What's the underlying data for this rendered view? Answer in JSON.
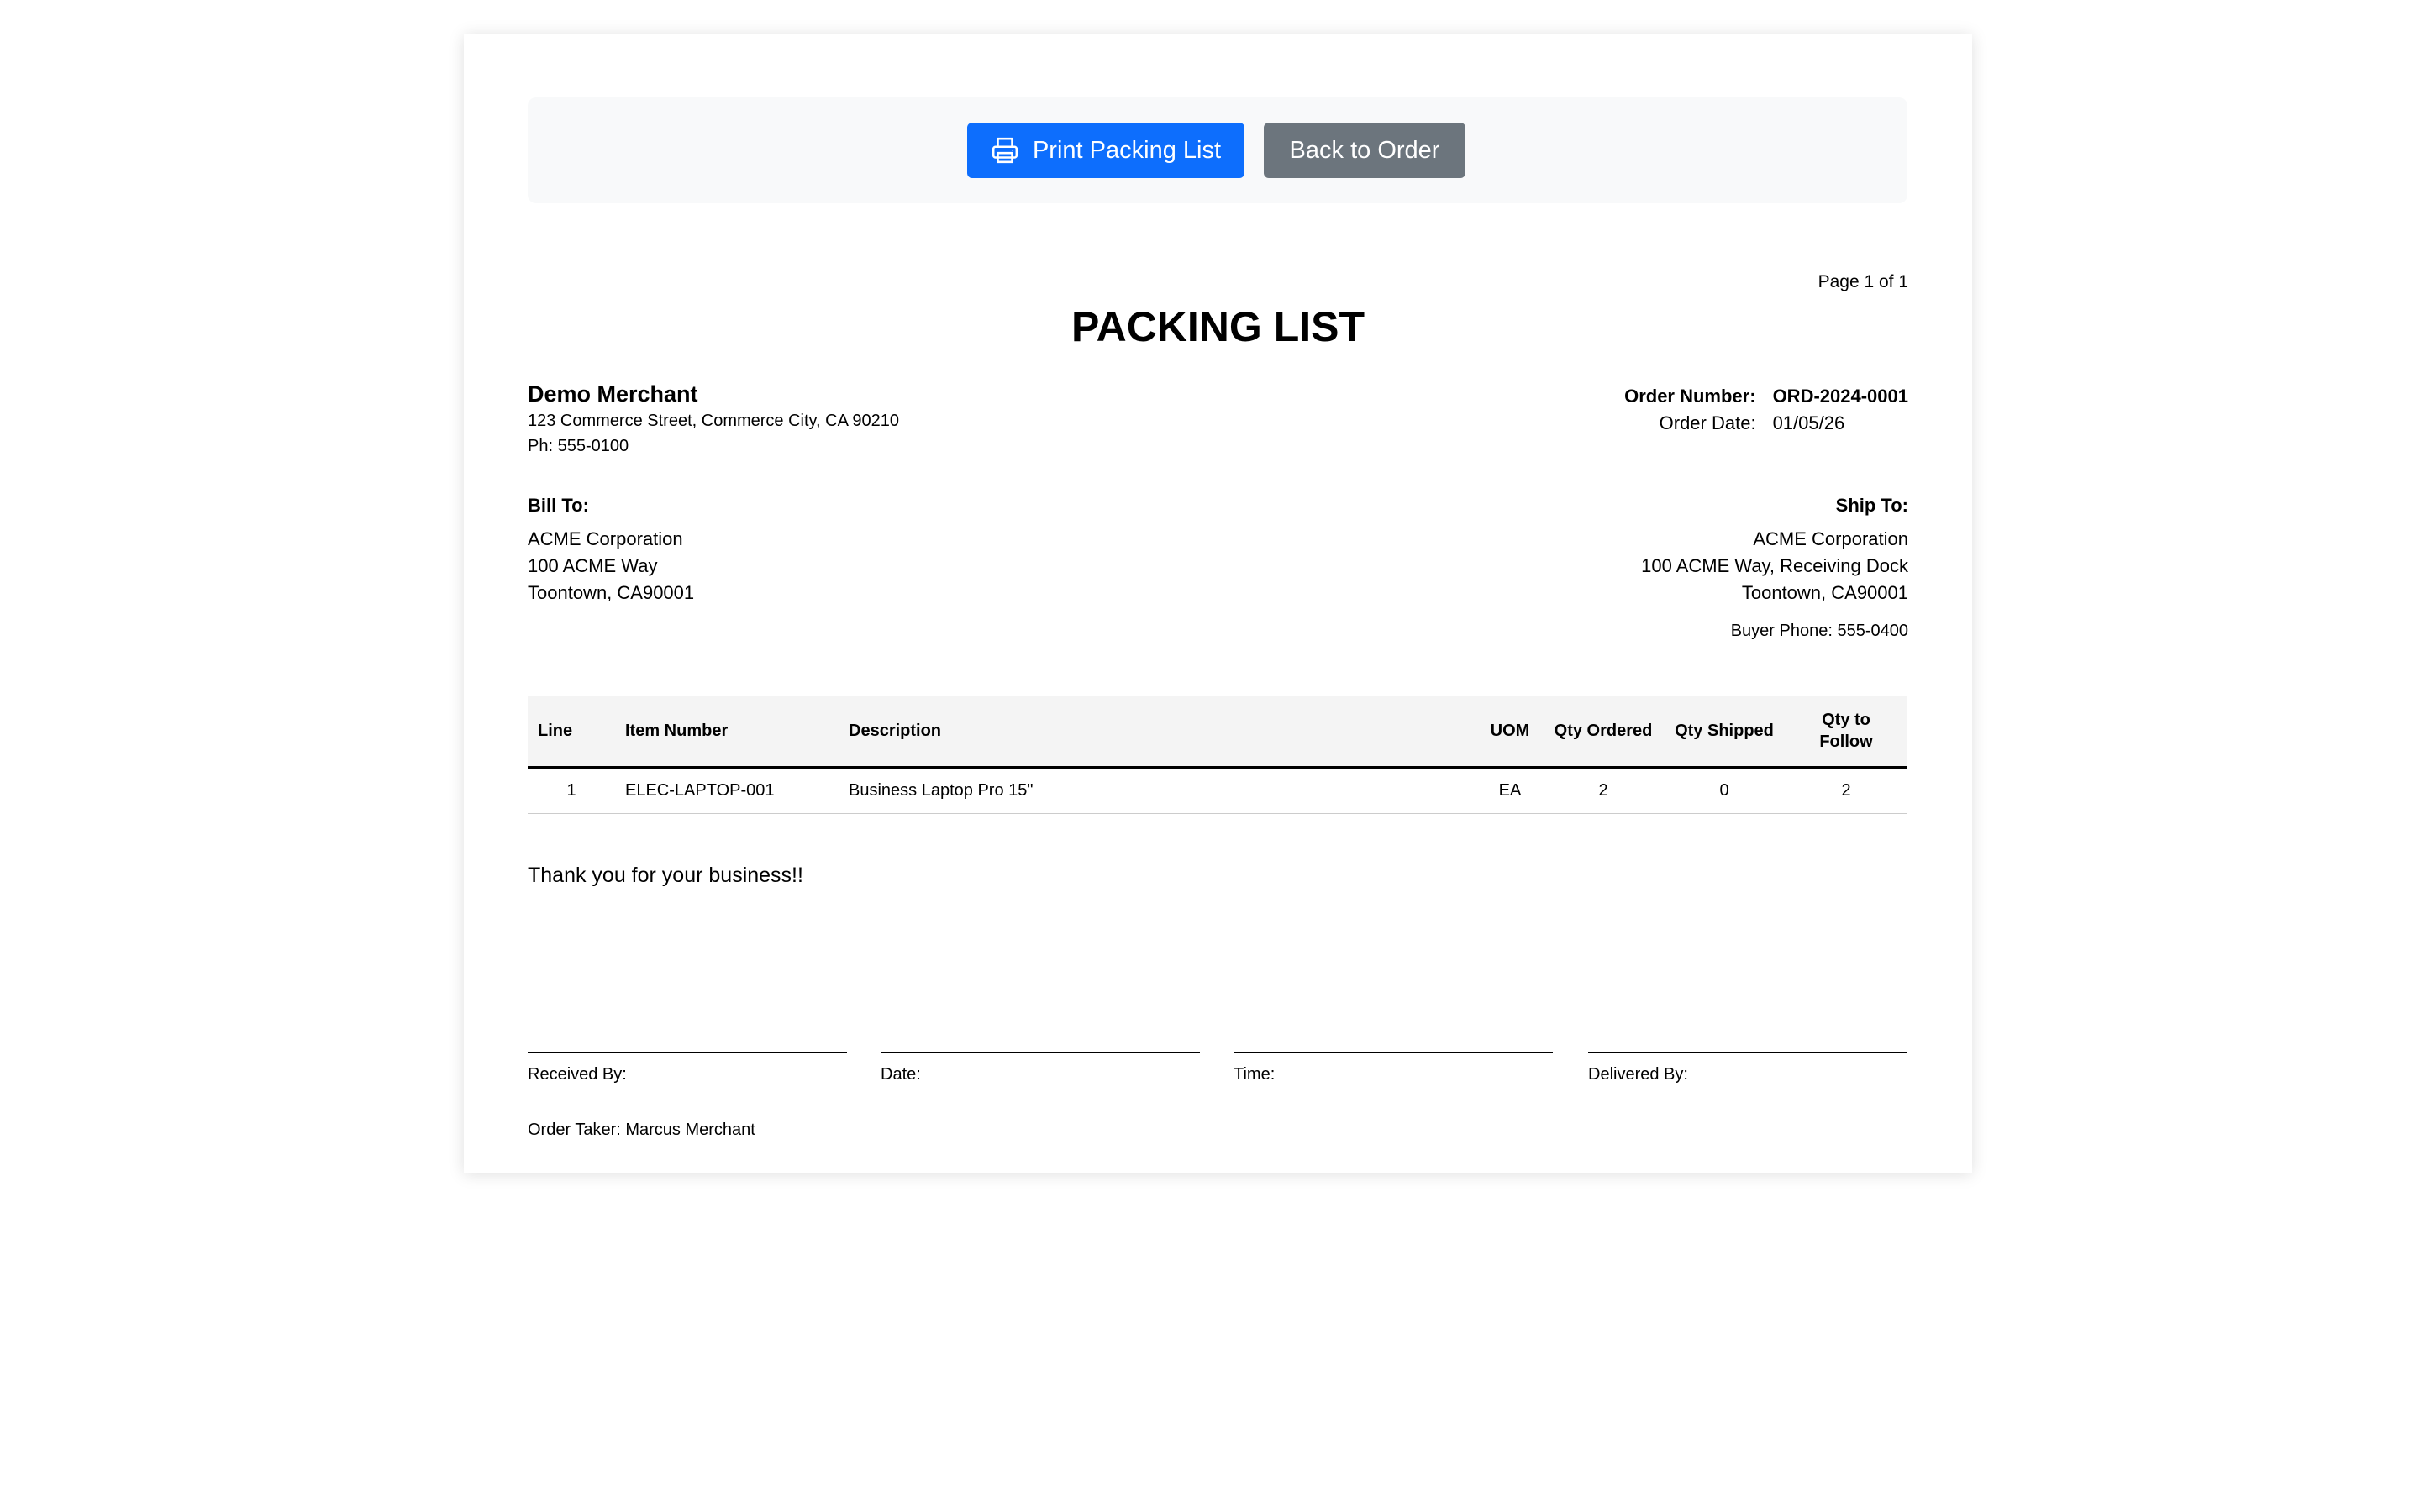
{
  "toolbar": {
    "print_label": "Print Packing List",
    "back_label": "Back to Order",
    "print_color": "#0d6efd",
    "back_color": "#6c757d"
  },
  "page_number": "Page 1 of 1",
  "title": "PACKING LIST",
  "merchant": {
    "name": "Demo Merchant",
    "address": "123 Commerce Street, Commerce City, CA 90210",
    "phone": "Ph: 555-0100"
  },
  "order": {
    "number_label": "Order Number:",
    "number": "ORD-2024-0001",
    "date_label": "Order Date:",
    "date": "01/05/26"
  },
  "bill_to": {
    "heading": "Bill To:",
    "name": "ACME Corporation",
    "street": "100 ACME Way",
    "city": "Toontown, CA90001"
  },
  "ship_to": {
    "heading": "Ship To:",
    "name": "ACME Corporation",
    "street": "100 ACME Way, Receiving Dock",
    "city": "Toontown, CA90001",
    "buyer_phone": "Buyer Phone: 555-0400"
  },
  "items_table": {
    "headers": {
      "line": "Line",
      "item_number": "Item Number",
      "description": "Description",
      "uom": "UOM",
      "qty_ordered": "Qty Ordered",
      "qty_shipped": "Qty Shipped",
      "qty_to_follow": "Qty to Follow"
    },
    "rows": [
      {
        "line": "1",
        "item_number": "ELEC-LAPTOP-001",
        "description": "Business Laptop Pro 15\"",
        "uom": "EA",
        "qty_ordered": "2",
        "qty_shipped": "0",
        "qty_to_follow": "2"
      }
    ]
  },
  "thanks": "Thank you for your business!!",
  "signatures": {
    "received_by": "Received By:",
    "date": "Date:",
    "time": "Time:",
    "delivered_by": "Delivered By:"
  },
  "order_taker": "Order Taker: Marcus Merchant"
}
